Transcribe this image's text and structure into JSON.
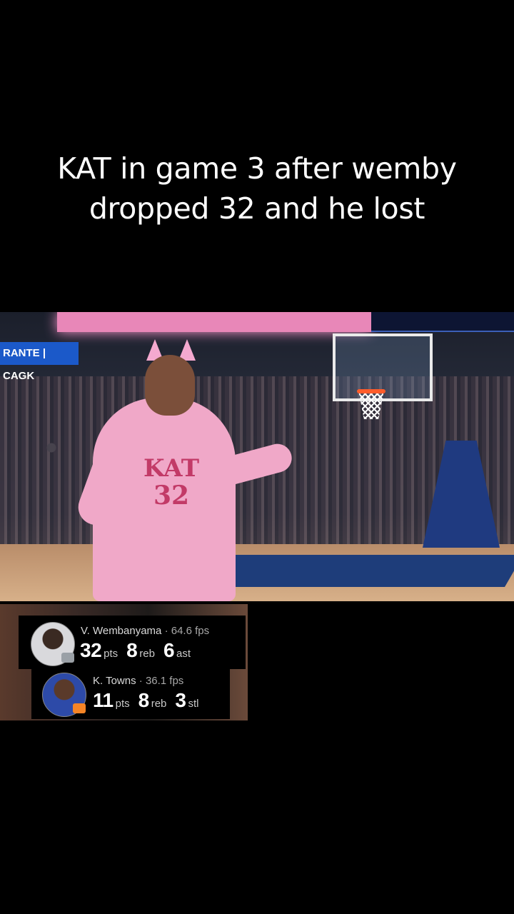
{
  "caption": {
    "line1": "KAT in game 3 after wemby",
    "line2": "dropped 32 and he lost"
  },
  "scene": {
    "left_ad_text": "RANTE | CAGK",
    "jersey_name": "KAT",
    "jersey_number": "32"
  },
  "players": [
    {
      "name": "V. Wembanyama",
      "separator": "·",
      "fps": "64.6 fps",
      "stats": [
        {
          "value": "32",
          "unit": "pts"
        },
        {
          "value": "8",
          "unit": "reb"
        },
        {
          "value": "6",
          "unit": "ast"
        }
      ]
    },
    {
      "name": "K. Towns",
      "separator": "·",
      "fps": "36.1 fps",
      "stats": [
        {
          "value": "11",
          "unit": "pts"
        },
        {
          "value": "8",
          "unit": "reb"
        },
        {
          "value": "3",
          "unit": "stl"
        }
      ]
    }
  ],
  "colors": {
    "background": "#000000",
    "jersey_pink": "#f0a8c8",
    "jersey_text": "#c23a67",
    "court_blue": "#1e3d7a"
  }
}
